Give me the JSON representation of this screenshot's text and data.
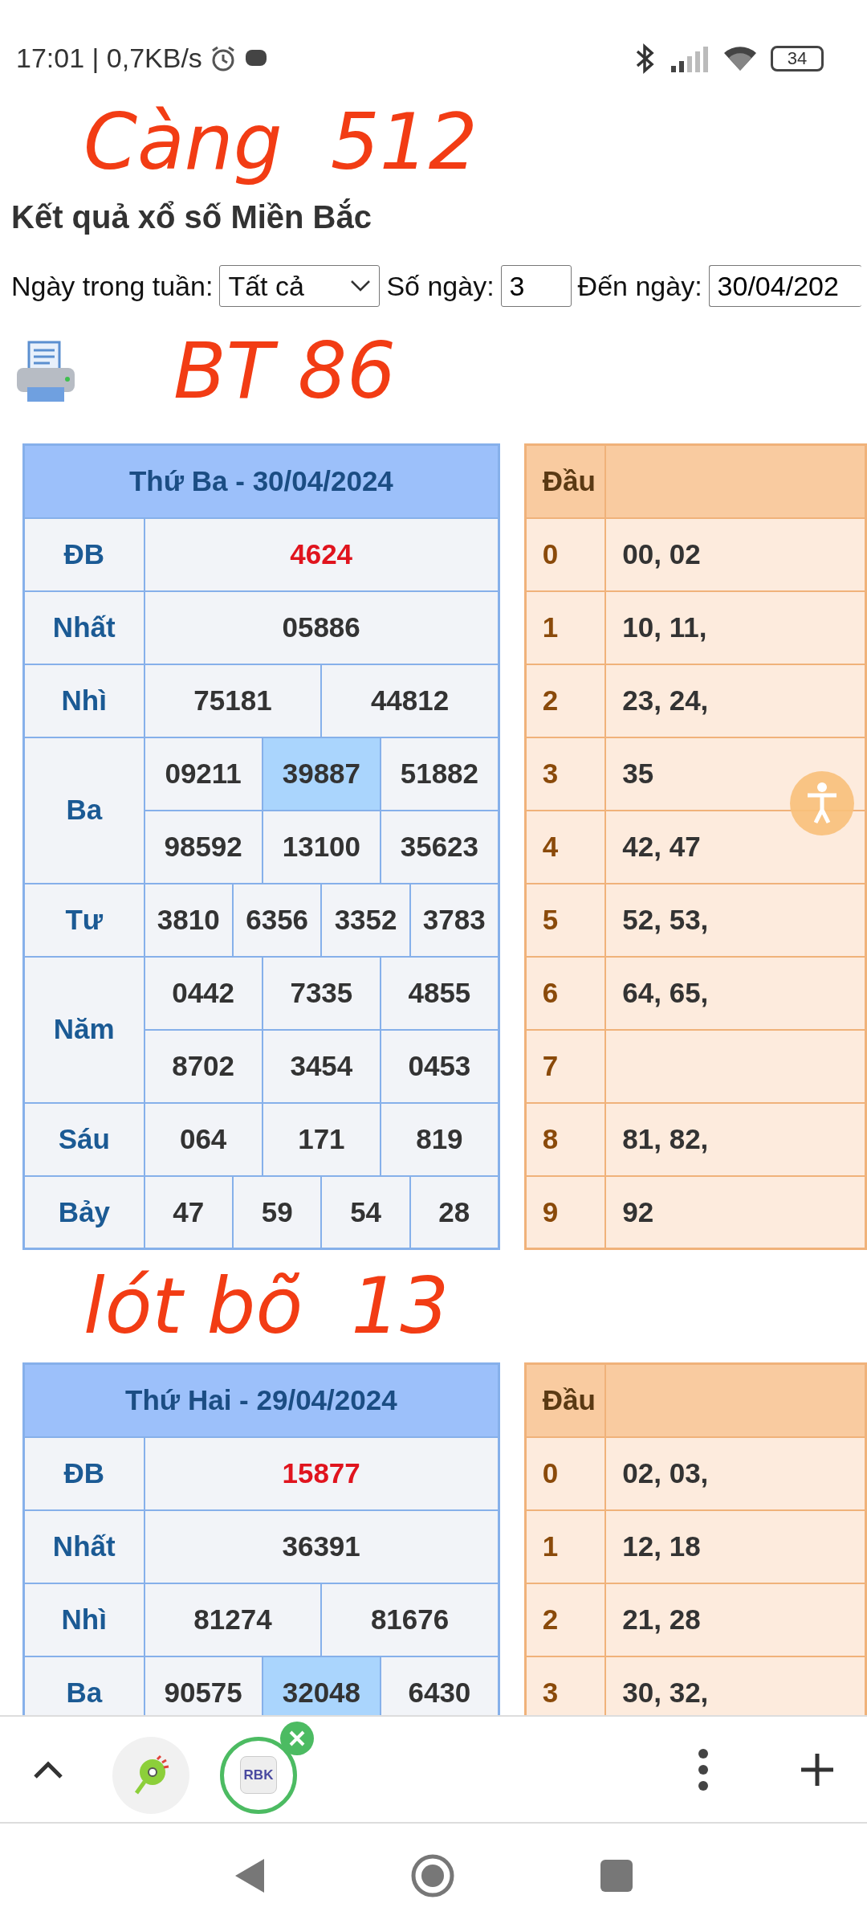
{
  "status_bar": {
    "time_speed": "17:01 | 0,7KB/s",
    "battery": "34"
  },
  "page_title": "Kết quả xổ số Miền Bắc",
  "filters": {
    "weekday_label": "Ngày trong tuần:",
    "weekday_value": "Tất cả",
    "days_label": "Số ngày:",
    "days_value": "3",
    "to_date_label": "Đến ngày:",
    "to_date_value": "30/04/202"
  },
  "results": [
    {
      "title": "Thứ Ba - 30/04/2024",
      "heads_header": "Đầu",
      "prizes": [
        {
          "label": "ĐB",
          "kind": "special",
          "rows": [
            [
              {
                "value": "4624",
                "highlighted": false
              }
            ]
          ]
        },
        {
          "label": "Nhất",
          "kind": "normal",
          "rows": [
            [
              {
                "value": "05886",
                "highlighted": false
              }
            ]
          ]
        },
        {
          "label": "Nhì",
          "kind": "normal",
          "rows": [
            [
              {
                "value": "75181",
                "highlighted": false
              },
              {
                "value": "44812",
                "highlighted": false
              }
            ]
          ]
        },
        {
          "label": "Ba",
          "kind": "normal",
          "rows": [
            [
              {
                "value": "09211",
                "highlighted": false
              },
              {
                "value": "39887",
                "highlighted": true
              },
              {
                "value": "51882",
                "highlighted": false
              }
            ],
            [
              {
                "value": "98592",
                "highlighted": false
              },
              {
                "value": "13100",
                "highlighted": false
              },
              {
                "value": "35623",
                "highlighted": false
              }
            ]
          ]
        },
        {
          "label": "Tư",
          "kind": "normal",
          "rows": [
            [
              {
                "value": "3810",
                "highlighted": false
              },
              {
                "value": "6356",
                "highlighted": false
              },
              {
                "value": "3352",
                "highlighted": false
              },
              {
                "value": "3783",
                "highlighted": false
              }
            ]
          ]
        },
        {
          "label": "Năm",
          "kind": "normal",
          "rows": [
            [
              {
                "value": "0442",
                "highlighted": false
              },
              {
                "value": "7335",
                "highlighted": false
              },
              {
                "value": "4855",
                "highlighted": false
              }
            ],
            [
              {
                "value": "8702",
                "highlighted": false
              },
              {
                "value": "3454",
                "highlighted": false
              },
              {
                "value": "0453",
                "highlighted": false
              }
            ]
          ]
        },
        {
          "label": "Sáu",
          "kind": "normal",
          "rows": [
            [
              {
                "value": "064",
                "highlighted": false
              },
              {
                "value": "171",
                "highlighted": false
              },
              {
                "value": "819",
                "highlighted": false
              }
            ]
          ]
        },
        {
          "label": "Bảy",
          "kind": "normal",
          "rows": [
            [
              {
                "value": "47",
                "highlighted": false
              },
              {
                "value": "59",
                "highlighted": false
              },
              {
                "value": "54",
                "highlighted": false
              },
              {
                "value": "28",
                "highlighted": false
              }
            ]
          ]
        }
      ],
      "heads": [
        {
          "digit": "0",
          "numbers": "00, 02"
        },
        {
          "digit": "1",
          "numbers": "10, 11,"
        },
        {
          "digit": "2",
          "numbers": "23, 24,"
        },
        {
          "digit": "3",
          "numbers": "35"
        },
        {
          "digit": "4",
          "numbers": "42, 47"
        },
        {
          "digit": "5",
          "numbers": "52, 53,"
        },
        {
          "digit": "6",
          "numbers": "64, 65,"
        },
        {
          "digit": "7"
        },
        {
          "digit": "8",
          "numbers": "81, 82,"
        },
        {
          "digit": "9",
          "numbers": "92"
        }
      ]
    },
    {
      "title": "Thứ Hai - 29/04/2024",
      "heads_header": "Đầu",
      "prizes": [
        {
          "label": "ĐB",
          "kind": "special",
          "rows": [
            [
              {
                "value": "15877",
                "highlighted": false
              }
            ]
          ]
        },
        {
          "label": "Nhất",
          "kind": "normal",
          "rows": [
            [
              {
                "value": "36391",
                "highlighted": false
              }
            ]
          ]
        },
        {
          "label": "Nhì",
          "kind": "normal",
          "rows": [
            [
              {
                "value": "81274",
                "highlighted": false
              },
              {
                "value": "81676",
                "highlighted": false
              }
            ]
          ]
        },
        {
          "label": "Ba",
          "kind": "normal",
          "rows": [
            [
              {
                "value": "90575",
                "highlighted": false
              },
              {
                "value": "32048",
                "highlighted": true
              },
              {
                "value": "6430",
                "highlighted": false
              }
            ]
          ]
        }
      ],
      "heads": [
        {
          "digit": "0",
          "numbers": "02, 03,"
        },
        {
          "digit": "1",
          "numbers": "12, 18"
        },
        {
          "digit": "2",
          "numbers": "21, 28"
        },
        {
          "digit": "3",
          "numbers": "30, 32,"
        }
      ]
    }
  ],
  "browser_bar": {
    "tabs": [
      {
        "selected": false
      },
      {
        "label": "RBK",
        "selected": true
      }
    ]
  },
  "handwritten_notes": [
    "Càng",
    "512",
    "BT 86",
    "lót bõ",
    "13"
  ]
}
